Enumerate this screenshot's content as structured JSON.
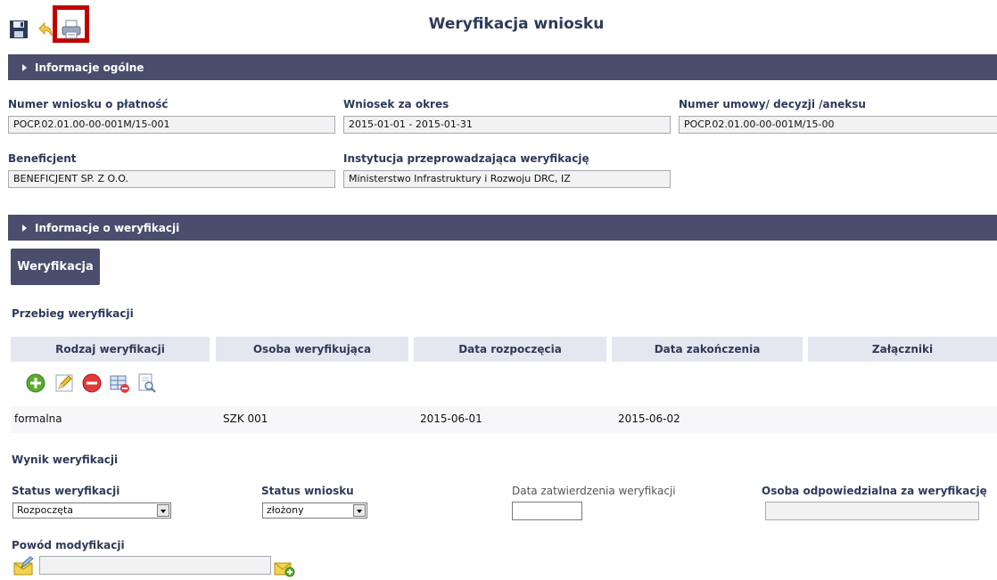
{
  "page": {
    "title": "Weryfikacja wniosku"
  },
  "toolbar": {
    "icons": [
      "save-icon",
      "undo-icon",
      "print-icon"
    ]
  },
  "sections": {
    "general": "Informacje ogólne",
    "verification": "Informacje o weryfikacji"
  },
  "general": {
    "payment_number_label": "Numer wniosku o płatność",
    "payment_number_value": "POCP.02.01.00-00-001M/15-001",
    "period_label": "Wniosek za okres",
    "period_value": "2015-01-01 - 2015-01-31",
    "contract_label": "Numer umowy/ decyzji /aneksu",
    "contract_value": "POCP.02.01.00-00-001M/15-00",
    "beneficiary_label": "Beneficjent",
    "beneficiary_value": "BENEFICJENT SP. Z O.O.",
    "institution_label": "Instytucja przeprowadzająca weryfikację",
    "institution_value": "Ministerstwo Infrastruktury i Rozwoju DRC, IZ"
  },
  "verification": {
    "tab_label": "Weryfikacja",
    "history_heading": "Przebieg weryfikacji",
    "columns": [
      "Rodzaj weryfikacji",
      "Osoba weryfikująca",
      "Data rozpoczęcia",
      "Data zakończenia",
      "Załączniki"
    ],
    "action_icons": [
      "add-icon",
      "edit-icon",
      "delete-icon",
      "table-delete-icon",
      "preview-icon"
    ],
    "rows": [
      {
        "type": "formalna",
        "person": "SZK 001",
        "start": "2015-06-01",
        "end": "2015-06-02",
        "attachments": ""
      }
    ],
    "result_heading": "Wynik weryfikacji",
    "status_verification_label": "Status weryfikacji",
    "status_verification_value": "Rozpoczęta",
    "status_application_label": "Status wniosku",
    "status_application_value": "złożony",
    "approval_date_label": "Data zatwierdzenia weryfikacji",
    "approval_date_value": "",
    "responsible_label": "Osoba odpowiedzialna za weryfikację",
    "responsible_value": "",
    "modification_label": "Powód modyfikacji",
    "modification_value": ""
  },
  "colors": {
    "section_bar": "#4a4e6c",
    "table_header": "#e5e7f0",
    "highlight": "#c00000",
    "heading_text": "#2e3a59"
  }
}
